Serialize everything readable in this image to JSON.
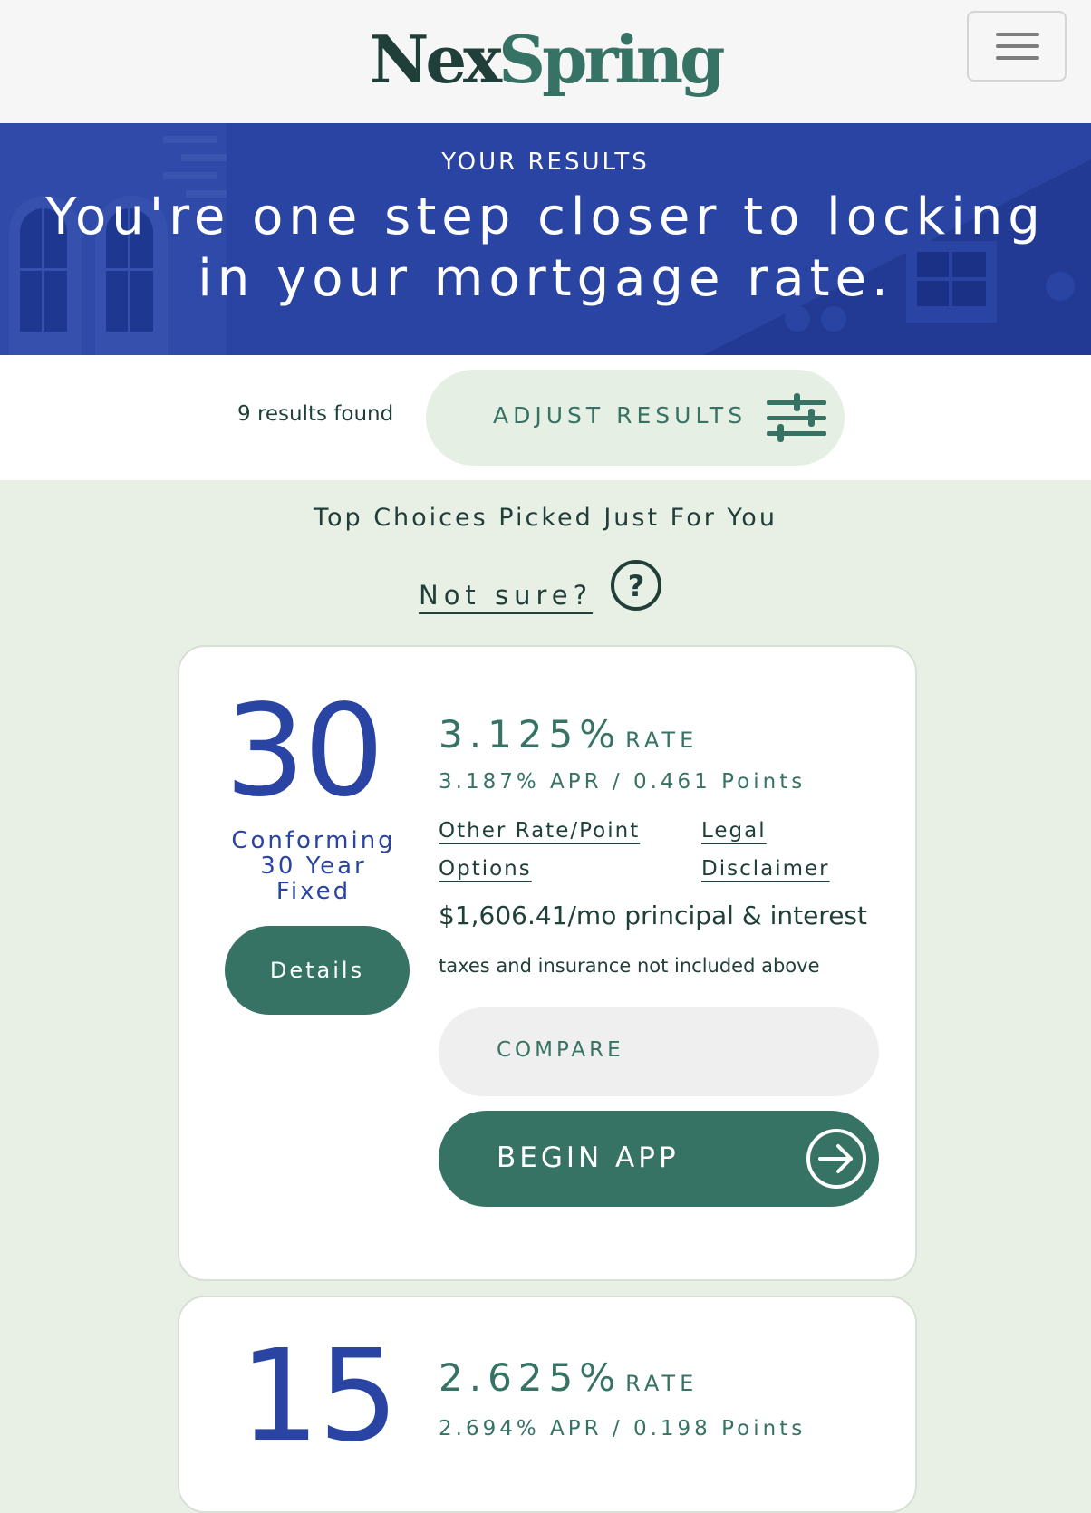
{
  "brand": {
    "name_part1": "Nex",
    "name_part2": "Spring"
  },
  "hero": {
    "eyebrow": "YOUR RESULTS",
    "title": "You're one step closer to locking in your mortgage rate."
  },
  "results": {
    "count_text": "9 results found",
    "adjust_label": "ADJUST RESULTS"
  },
  "top_choices": {
    "heading": "Top Choices Picked Just For You",
    "not_sure": "Not sure?"
  },
  "cards": [
    {
      "term": "30",
      "loan_name": "Conforming 30 Year Fixed",
      "rate": "3.125%",
      "rate_suffix": "RATE",
      "apr_points": "3.187% APR / 0.461 Points",
      "other_options_link": "Other Rate/Point Options",
      "legal_link": "Legal Disclaimer",
      "payment": "$1,606.41/mo principal & interest",
      "taxes_note": "taxes and insurance not included above",
      "details_label": "Details",
      "compare_label": "COMPARE",
      "begin_label": "BEGIN APP"
    },
    {
      "term": "15",
      "rate": "2.625%",
      "rate_suffix": "RATE",
      "apr_points": "2.694% APR / 0.198 Points"
    }
  ],
  "icons": {
    "menu": "hamburger-menu-icon",
    "adjust": "sliders-icon",
    "help": "question-circle-icon",
    "begin": "arrow-right-circle-icon"
  },
  "colors": {
    "primary_green": "#377364",
    "dark_green": "#1f3f38",
    "hero_blue": "#2a44a3",
    "page_bg": "#e8efe5"
  }
}
